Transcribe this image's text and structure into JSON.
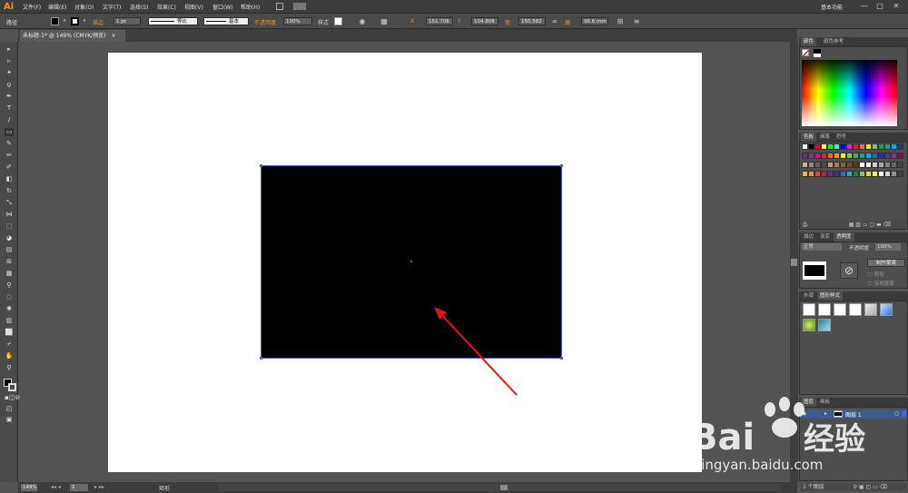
{
  "app": {
    "logo": "Ai",
    "workspace": "基本功能"
  },
  "menu": [
    "文件(F)",
    "编辑(E)",
    "对象(O)",
    "文字(T)",
    "选择(S)",
    "效果(C)",
    "视图(V)",
    "窗口(W)",
    "帮助(H)"
  ],
  "window_controls": [
    "—",
    "□",
    "✕"
  ],
  "control_bar": {
    "selection_label": "路径",
    "stroke_label": "描边",
    "stroke_weight": "1 pt",
    "profile": "等比",
    "brush": "基本",
    "opacity_label": "不透明度",
    "opacity_value": "100%",
    "style_label": "样式",
    "x_label": "X",
    "x_value": "151.706",
    "y_label": "Y",
    "y_value": "104.808",
    "w_label": "宽",
    "w_value": "150.582",
    "h_label": "高",
    "h_value": "96.6 mm"
  },
  "document": {
    "tab_title": "未标题-1* @ 149% (CMYK/预览)",
    "close": "×"
  },
  "status": {
    "zoom": "149%",
    "page": "1",
    "tool_name": "矩形"
  },
  "panels": {
    "color": {
      "tabs": [
        "颜色",
        "颜色参考"
      ]
    },
    "swatches": {
      "tabs": [
        "色板",
        "画笔",
        "符号"
      ]
    },
    "transparency": {
      "tabs": [
        "描边",
        "渐变",
        "透明度"
      ],
      "mode": "正常",
      "opacity_label": "不透明度",
      "opacity_value": "100%",
      "make_mask": "制作蒙版",
      "clip": "剪切",
      "invert_mask": "反相蒙版"
    },
    "graphic_styles": {
      "tabs": [
        "外观",
        "图形样式"
      ]
    },
    "layers": {
      "tabs": [
        "图层",
        "画板"
      ],
      "layer_name": "图层 1",
      "footer": "1 个图层"
    }
  },
  "colors": {
    "accent": "#e8912f",
    "selection": "#4a63c9",
    "shape_fill": "#000000",
    "arrow": "#e8140c"
  },
  "watermark": {
    "brand": "Bai",
    "brand2": "经验",
    "url": "jingyan.baidu.com"
  }
}
